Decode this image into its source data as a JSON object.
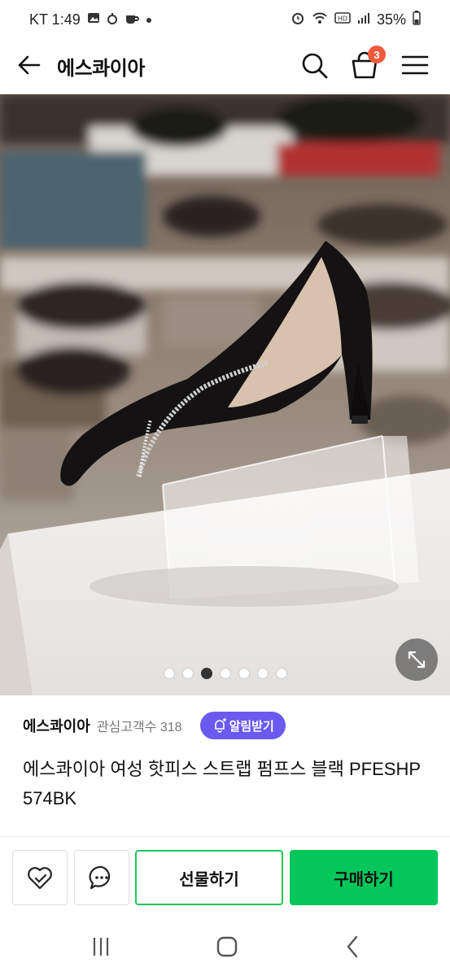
{
  "status": {
    "carrier_time": "KT 1:49",
    "battery": "35%"
  },
  "header": {
    "title": "에스콰이아",
    "cart_count": "3"
  },
  "gallery": {
    "dot_count": 7,
    "active_index": 2
  },
  "product": {
    "seller": "에스콰이아",
    "interest": "관심고객수 318",
    "alarm_label": "알림받기",
    "name": "에스콰이아 여성 핫피스 스트랩 펌프스 블랙 PFESHP574BK"
  },
  "actions": {
    "gift_label": "선물하기",
    "buy_label": "구매하기"
  },
  "colors": {
    "accent_green": "#03c75a",
    "alarm_purple": "#6a5af0",
    "badge_red": "#f05a3c"
  }
}
